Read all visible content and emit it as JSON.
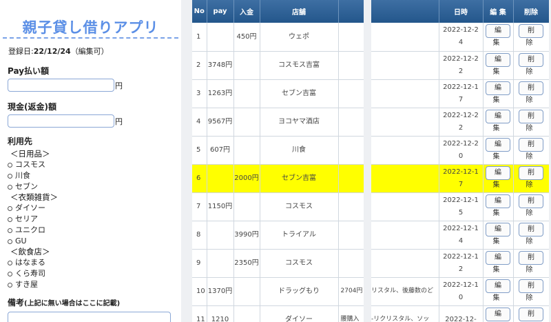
{
  "form": {
    "title": "親子貸し借りアプリ",
    "registered_prefix": "登録日:",
    "registered_date": "22/12/24",
    "registered_suffix": "（編集可）",
    "pay_label": "Pay払い額",
    "pay_value": "",
    "pay_unit": "円",
    "cash_label": "現金(返金)額",
    "cash_value": "",
    "cash_unit": "円",
    "usage_label": "利用先",
    "groups": [
      {
        "title": "＜日用品＞",
        "options": [
          "コスモス",
          "川食",
          "セブン"
        ]
      },
      {
        "title": "＜衣類雑貨＞",
        "options": [
          "ダイソー",
          "セリア",
          "ユニクロ",
          "GU"
        ]
      },
      {
        "title": "＜飲食店＞",
        "options": [
          "はなまる",
          "くら寿司",
          "すき屋"
        ]
      }
    ],
    "note_label": "備考",
    "note_hint": "(上記に無い場合はここに記載)"
  },
  "table_left": {
    "headers": {
      "no": "No",
      "pay": "pay",
      "deposit": "入金",
      "store": "店舗",
      "memo": ""
    },
    "rows": [
      {
        "no": "1",
        "pay": "",
        "deposit": "450円",
        "store": "ウェポ",
        "memo": ""
      },
      {
        "no": "2",
        "pay": "3748円",
        "deposit": "",
        "store": "コスモス吉富",
        "memo": ""
      },
      {
        "no": "3",
        "pay": "1263円",
        "deposit": "",
        "store": "セブン吉富",
        "memo": ""
      },
      {
        "no": "4",
        "pay": "9567円",
        "deposit": "",
        "store": "ヨコヤマ酒店",
        "memo": ""
      },
      {
        "no": "5",
        "pay": "607円",
        "deposit": "",
        "store": "川食",
        "memo": ""
      },
      {
        "no": "6",
        "pay": "",
        "deposit": "2000円",
        "store": "セブン吉富",
        "memo": ""
      },
      {
        "no": "7",
        "pay": "1150円",
        "deposit": "",
        "store": "コスモス",
        "memo": ""
      },
      {
        "no": "8",
        "pay": "",
        "deposit": "3990円",
        "store": "トライアル",
        "memo": ""
      },
      {
        "no": "9",
        "pay": "",
        "deposit": "2350円",
        "store": "コスモス",
        "memo": ""
      },
      {
        "no": "10",
        "pay": "1370円",
        "deposit": "",
        "store": "ドラッグもり",
        "memo": "2704円"
      },
      {
        "no": "11",
        "pay": "1210",
        "deposit": "",
        "store": "ダイソー",
        "memo": "腰購入"
      }
    ]
  },
  "table_right": {
    "headers": {
      "memo": "",
      "date": "日時",
      "edit": "編 集",
      "delete": "削除"
    },
    "edit_label": "編集",
    "delete_label": "削除",
    "rows": [
      {
        "memo": "",
        "date": "2022-12-24"
      },
      {
        "memo": "",
        "date": "2022-12-22"
      },
      {
        "memo": "",
        "date": "2022-12-17"
      },
      {
        "memo": "",
        "date": "2022-12-22"
      },
      {
        "memo": "",
        "date": "2022-12-20"
      },
      {
        "memo": "",
        "date": "2022-12-17"
      },
      {
        "memo": "",
        "date": "2022-12-15"
      },
      {
        "memo": "",
        "date": "2022-12-14"
      },
      {
        "memo": "",
        "date": "2022-12-12"
      },
      {
        "memo": "リスタル、後藤数のど",
        "date": "2022-12-10"
      },
      {
        "memo": "-リクリスタル、ソッ",
        "date": "2022-12-"
      }
    ]
  },
  "highlight_row_index": 5,
  "colors": {
    "accent": "#5b8fe6",
    "header": "#2d5f94",
    "highlight": "#ffff00"
  }
}
